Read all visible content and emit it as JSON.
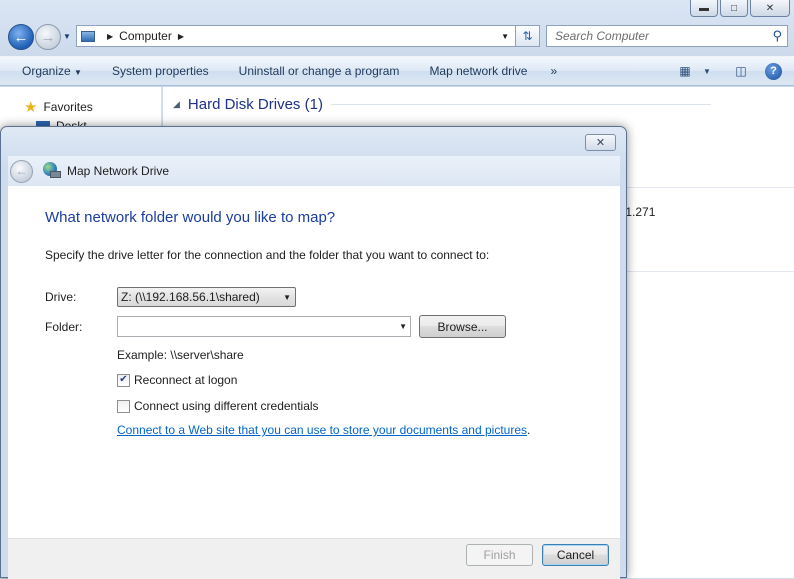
{
  "explorer": {
    "address": {
      "crumb": "Computer"
    },
    "search": {
      "placeholder": "Search Computer"
    },
    "toolbar": {
      "organize": "Organize",
      "system_properties": "System properties",
      "uninstall": "Uninstall or change a program",
      "map_network_drive": "Map network drive",
      "more": "»"
    },
    "nav": {
      "favorites": "Favorites",
      "desktop_partial": "Deskt"
    },
    "content": {
      "group_header": "Hard Disk Drives (1)",
      "partial_text": ".1.271"
    }
  },
  "dialog": {
    "title": "Map Network Drive",
    "heading": "What network folder would you like to map?",
    "instruction": "Specify the drive letter for the connection and the folder that you want to connect to:",
    "drive_label": "Drive:",
    "drive_value": "Z: (\\\\192.168.56.1\\shared)",
    "folder_label": "Folder:",
    "folder_value": "",
    "browse": "Browse...",
    "example": "Example: \\\\server\\share",
    "reconnect": {
      "label": "Reconnect at logon",
      "checked": true
    },
    "credentials": {
      "label": "Connect using different credentials",
      "checked": false
    },
    "link_text": "Connect to a Web site that you can use to store your documents and pictures",
    "link_period": ".",
    "finish": "Finish",
    "cancel": "Cancel"
  }
}
